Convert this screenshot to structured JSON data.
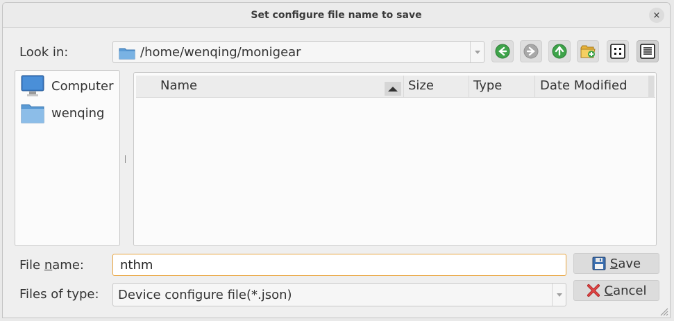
{
  "dialog": {
    "title": "Set configure file name to save",
    "close_glyph": "×"
  },
  "look_in": {
    "label": "Look in:",
    "path": "/home/wenqing/monigear"
  },
  "toolbar": {
    "back_icon": "back-arrow-icon",
    "forward_icon": "forward-arrow-icon",
    "up_icon": "up-arrow-icon",
    "new_folder_icon": "new-folder-icon",
    "list_view_icon": "list-view-icon",
    "detail_view_icon": "detail-view-icon"
  },
  "sidebar": {
    "items": [
      {
        "label": "Computer",
        "icon": "computer-icon"
      },
      {
        "label": "wenqing",
        "icon": "folder-icon"
      }
    ]
  },
  "file_list": {
    "columns": [
      "Name",
      "Size",
      "Type",
      "Date Modified"
    ],
    "sort_column": "Name",
    "rows": []
  },
  "file_name": {
    "label_pre": "File ",
    "label_mnemonic": "n",
    "label_post": "ame:",
    "value": "nthm"
  },
  "file_type": {
    "label": "Files of type:",
    "value": "Device configure file(*.json)"
  },
  "buttons": {
    "save_mnemonic": "S",
    "save_rest": "ave",
    "cancel_mnemonic": "C",
    "cancel_rest": "ancel"
  },
  "colors": {
    "focus_border": "#e8a33c",
    "folder_blue": "#5b9bd5",
    "nav_green": "#3ea34a"
  }
}
